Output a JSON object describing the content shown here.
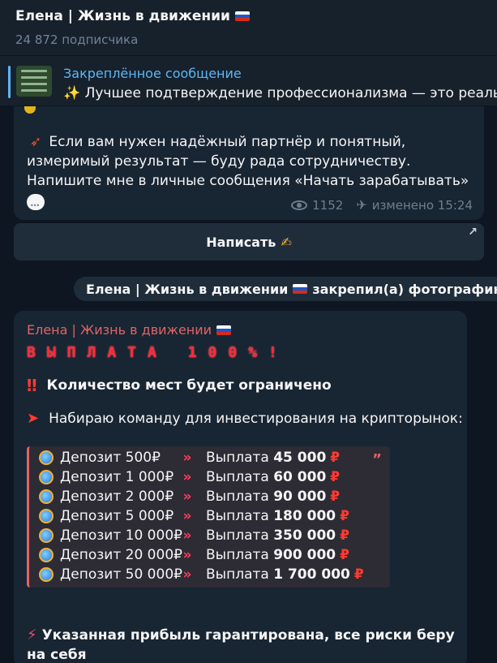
{
  "header": {
    "title": "Елена | Жизнь в движении",
    "subscribers": "24 872 подписчика"
  },
  "pinned": {
    "title": "Закреплённое сообщение",
    "text": "✨ Лучшее подтверждение профессионализма — это реальн"
  },
  "message1": {
    "lines": [
      "Если вам нужен надёжный партнёр и понятный,",
      "измеримый результат — буду рада сотрудничеству.",
      "Напишите мне в личные сообщения «Начать зарабатывать»"
    ],
    "views": "1152",
    "edited": "изменено 15:24"
  },
  "button": {
    "label": "Написать",
    "hand_emoji": "✍"
  },
  "service": {
    "author": "Елена | Жизнь в движении",
    "action": "закрепил(а) фотографию"
  },
  "message2": {
    "author": "Елена | Жизнь в движении",
    "banner": "ВЫПЛАТА 100%!",
    "line1": "Количество мест будет ограничено",
    "line2": "Набираю команду для инвестирования на крипторынок:",
    "rows": [
      {
        "deposit": "Депозит    500₽",
        "payout": "45 000"
      },
      {
        "deposit": "Депозит 1 000₽",
        "payout": "60 000"
      },
      {
        "deposit": "Депозит 2 000₽",
        "payout": "90 000"
      },
      {
        "deposit": "Депозит 5 000₽",
        "payout": "180 000"
      },
      {
        "deposit": "Депозит 10 000₽",
        "payout": "350 000"
      },
      {
        "deposit": "Депозит 20 000₽",
        "payout": "900 000"
      },
      {
        "deposit": "Депозит 50 000₽",
        "payout": "1 700 000"
      }
    ],
    "payout_label": "Выплата",
    "arrows": "»",
    "rub": "₽",
    "final": "Указанная прибыль гарантирована, все риски беру на себя"
  }
}
